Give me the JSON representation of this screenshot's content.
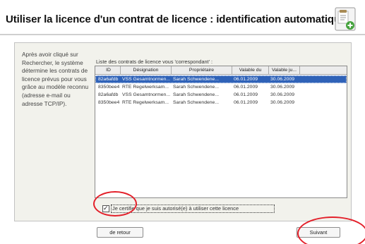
{
  "dialog": {
    "title": "Utiliser la licence d'un contrat de licence : identification automatique",
    "icon": "license-document-icon"
  },
  "description": "Après avoir cliqué sur Rechercher, le système détermine les contrats de licence prévus pour vous grâce au modèle reconnu (adresse e-mail ou adresse TCP/IP).",
  "list": {
    "label": "Liste des contrats de licence vous 'correspondant' :",
    "columns": [
      "ID",
      "Désignation",
      "Propriétaire",
      "Valable du",
      "Valable ju..."
    ],
    "rows": [
      {
        "id": "82a6afdb",
        "designation": "VSS Gesamtnormen...",
        "owner": "Sarah Schwendene...",
        "valid_from": "06.01.2009",
        "valid_to": "30.06.2009",
        "selected": true
      },
      {
        "id": "8350bee4",
        "designation": "RTE Regelwerksam...",
        "owner": "Sarah Schwendene...",
        "valid_from": "06.01.2009",
        "valid_to": "30.06.2009",
        "selected": false
      },
      {
        "id": "82a6afdb",
        "designation": "VSS Gesamtnormen...",
        "owner": "Sarah Schwendene...",
        "valid_from": "06.01.2009",
        "valid_to": "30.06.2009",
        "selected": false
      },
      {
        "id": "8350bee4",
        "designation": "RTE Regelwerksam...",
        "owner": "Sarah Schwendene...",
        "valid_from": "06.01.2009",
        "valid_to": "30.06.2009",
        "selected": false
      }
    ]
  },
  "certify": {
    "checked": true,
    "label": "Je certifie que je suis autorisé(e) à utiliser cette licence"
  },
  "buttons": {
    "back_label": "de retour",
    "next_label": "Suivant"
  },
  "annotation_color": "#e3202a",
  "selection_color": "#2f62b8"
}
